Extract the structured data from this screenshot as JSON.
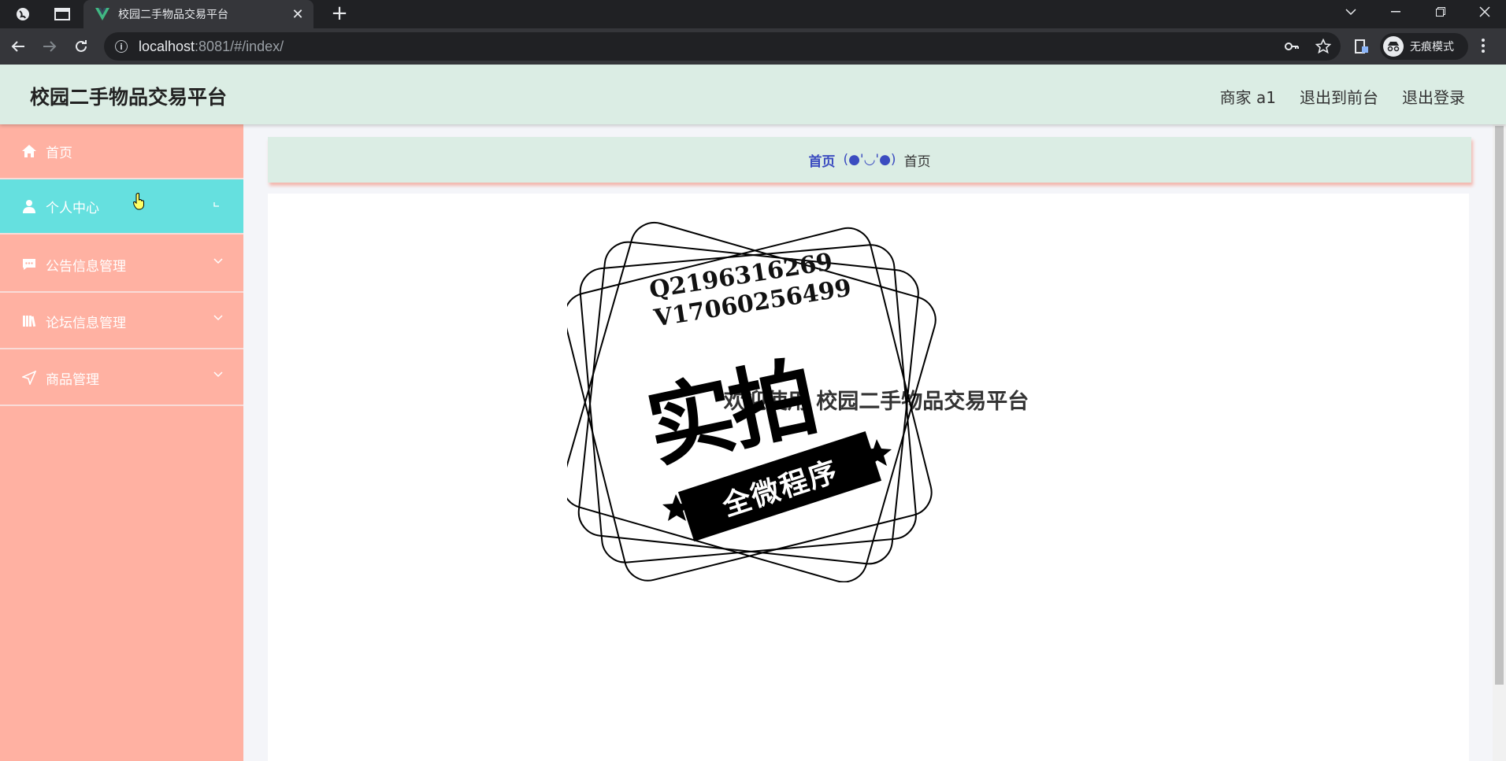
{
  "browser": {
    "tab_title": "校园二手物品交易平台",
    "new_tab": "+",
    "url_host": "localhost",
    "url_rest": ":8081/#/index/",
    "incognito_label": "无痕模式"
  },
  "header": {
    "title": "校园二手物品交易平台",
    "user": "商家 a1",
    "back_to_front": "退出到前台",
    "logout": "退出登录"
  },
  "sidebar": {
    "items": [
      {
        "label": "首页",
        "icon": "home-icon"
      },
      {
        "label": "个人中心",
        "icon": "user-icon",
        "active": true
      },
      {
        "label": "公告信息管理",
        "icon": "chat-icon"
      },
      {
        "label": "论坛信息管理",
        "icon": "books-icon"
      },
      {
        "label": "商品管理",
        "icon": "send-icon"
      }
    ]
  },
  "breadcrumb": {
    "home": "首页",
    "face": "(●'◡'●)",
    "current": "首页"
  },
  "main": {
    "welcome": "欢迎使用 校园二手物品交易平台"
  },
  "stamp": {
    "line1": "Q2196316269",
    "line2": "V17060256499",
    "big": "实拍",
    "banner": "全微程序"
  },
  "colors": {
    "header_bg": "#dbede4",
    "sidebar_bg": "#ffb1a2",
    "active_item": "#65e0df",
    "breadcrumb_link": "#3b4cc0"
  }
}
